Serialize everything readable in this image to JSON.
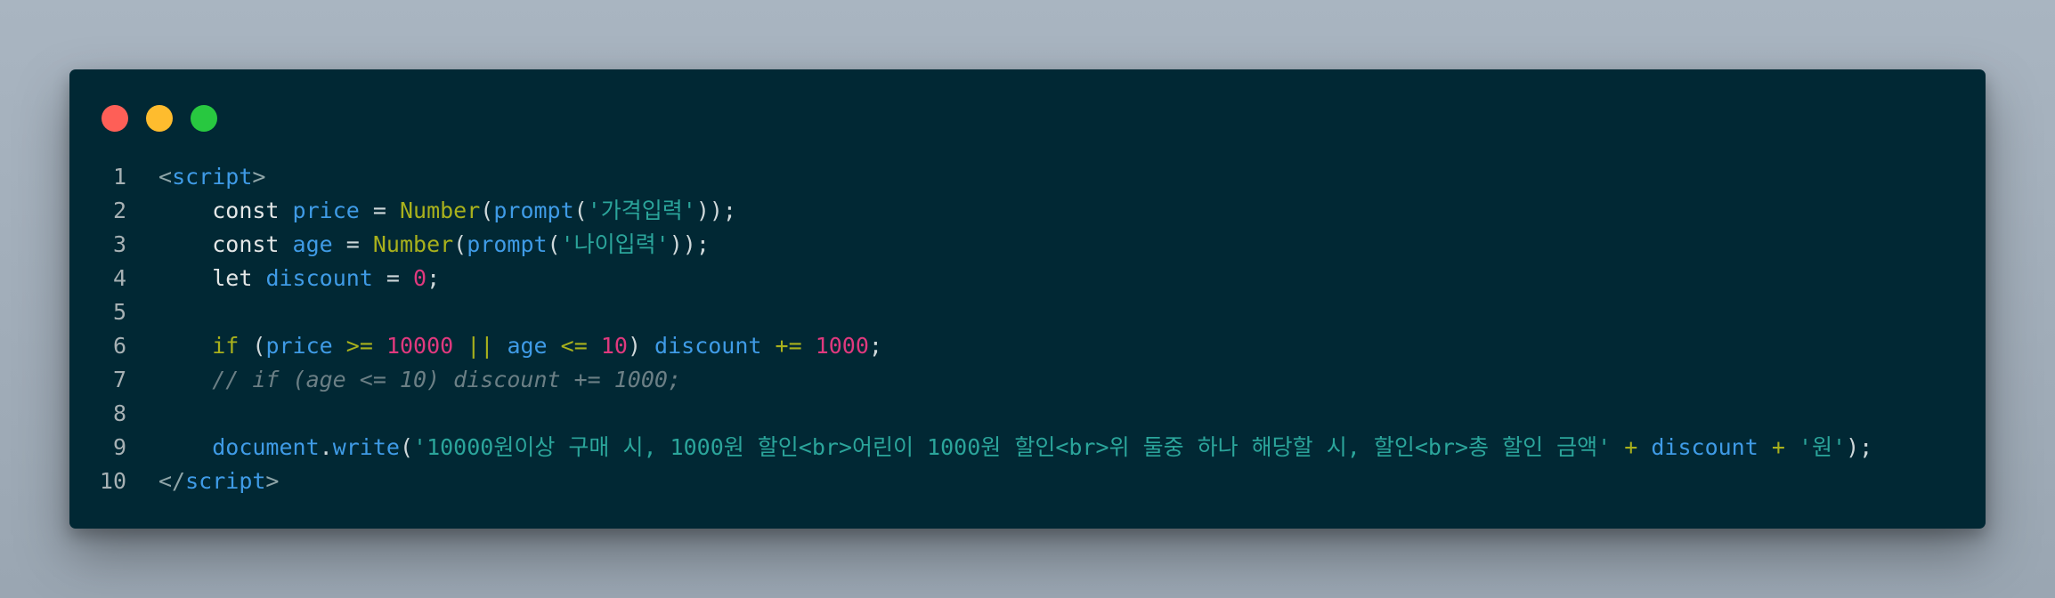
{
  "window": {
    "controls": {
      "close_color": "#fe5f57",
      "minimize_color": "#febc2e",
      "maximize_color": "#28c840"
    },
    "background": "#012834"
  },
  "lines": [
    {
      "number": "1",
      "tokens": [
        {
          "text": "<",
          "type": "ang"
        },
        {
          "text": "script",
          "type": "tag"
        },
        {
          "text": ">",
          "type": "ang"
        }
      ]
    },
    {
      "number": "2",
      "tokens": [
        {
          "text": "    ",
          "type": "punc"
        },
        {
          "text": "const",
          "type": "kw"
        },
        {
          "text": " ",
          "type": "punc"
        },
        {
          "text": "price",
          "type": "var"
        },
        {
          "text": " = ",
          "type": "punc"
        },
        {
          "text": "Number",
          "type": "fn"
        },
        {
          "text": "(",
          "type": "punc"
        },
        {
          "text": "prompt",
          "type": "var"
        },
        {
          "text": "(",
          "type": "punc"
        },
        {
          "text": "'가격입력'",
          "type": "str"
        },
        {
          "text": "));",
          "type": "punc"
        }
      ]
    },
    {
      "number": "3",
      "tokens": [
        {
          "text": "    ",
          "type": "punc"
        },
        {
          "text": "const",
          "type": "kw"
        },
        {
          "text": " ",
          "type": "punc"
        },
        {
          "text": "age",
          "type": "var"
        },
        {
          "text": " = ",
          "type": "punc"
        },
        {
          "text": "Number",
          "type": "fn"
        },
        {
          "text": "(",
          "type": "punc"
        },
        {
          "text": "prompt",
          "type": "var"
        },
        {
          "text": "(",
          "type": "punc"
        },
        {
          "text": "'나이입력'",
          "type": "str"
        },
        {
          "text": "));",
          "type": "punc"
        }
      ]
    },
    {
      "number": "4",
      "tokens": [
        {
          "text": "    ",
          "type": "punc"
        },
        {
          "text": "let",
          "type": "kw"
        },
        {
          "text": " ",
          "type": "punc"
        },
        {
          "text": "discount",
          "type": "var"
        },
        {
          "text": " = ",
          "type": "punc"
        },
        {
          "text": "0",
          "type": "num"
        },
        {
          "text": ";",
          "type": "punc"
        }
      ]
    },
    {
      "number": "5",
      "tokens": []
    },
    {
      "number": "6",
      "tokens": [
        {
          "text": "    ",
          "type": "punc"
        },
        {
          "text": "if",
          "type": "fn"
        },
        {
          "text": " (",
          "type": "punc"
        },
        {
          "text": "price",
          "type": "var"
        },
        {
          "text": " ",
          "type": "punc"
        },
        {
          "text": ">=",
          "type": "op"
        },
        {
          "text": " ",
          "type": "punc"
        },
        {
          "text": "10000",
          "type": "num"
        },
        {
          "text": " ",
          "type": "punc"
        },
        {
          "text": "||",
          "type": "op"
        },
        {
          "text": " ",
          "type": "punc"
        },
        {
          "text": "age",
          "type": "var"
        },
        {
          "text": " ",
          "type": "punc"
        },
        {
          "text": "<=",
          "type": "op"
        },
        {
          "text": " ",
          "type": "punc"
        },
        {
          "text": "10",
          "type": "num"
        },
        {
          "text": ") ",
          "type": "punc"
        },
        {
          "text": "discount",
          "type": "var"
        },
        {
          "text": " ",
          "type": "punc"
        },
        {
          "text": "+=",
          "type": "op"
        },
        {
          "text": " ",
          "type": "punc"
        },
        {
          "text": "1000",
          "type": "num"
        },
        {
          "text": ";",
          "type": "punc"
        }
      ]
    },
    {
      "number": "7",
      "tokens": [
        {
          "text": "    ",
          "type": "punc"
        },
        {
          "text": "// if (age <= 10) discount += 1000;",
          "type": "cm"
        }
      ]
    },
    {
      "number": "8",
      "tokens": []
    },
    {
      "number": "9",
      "tokens": [
        {
          "text": "    ",
          "type": "punc"
        },
        {
          "text": "document",
          "type": "var"
        },
        {
          "text": ".",
          "type": "punc"
        },
        {
          "text": "write",
          "type": "var"
        },
        {
          "text": "(",
          "type": "punc"
        },
        {
          "text": "'10000원이상 구매 시, 1000원 할인<br>어린이 1000원 할인<br>위 둘중 하나 해당할 시, 할인<br>총 할인 금액'",
          "type": "str"
        },
        {
          "text": " ",
          "type": "punc"
        },
        {
          "text": "+",
          "type": "op"
        },
        {
          "text": " ",
          "type": "punc"
        },
        {
          "text": "discount",
          "type": "var"
        },
        {
          "text": " ",
          "type": "punc"
        },
        {
          "text": "+",
          "type": "op"
        },
        {
          "text": " ",
          "type": "punc"
        },
        {
          "text": "'원'",
          "type": "str"
        },
        {
          "text": ");",
          "type": "punc"
        }
      ]
    },
    {
      "number": "10",
      "tokens": [
        {
          "text": "</",
          "type": "ang"
        },
        {
          "text": "script",
          "type": "tag"
        },
        {
          "text": ">",
          "type": "ang"
        }
      ]
    }
  ]
}
